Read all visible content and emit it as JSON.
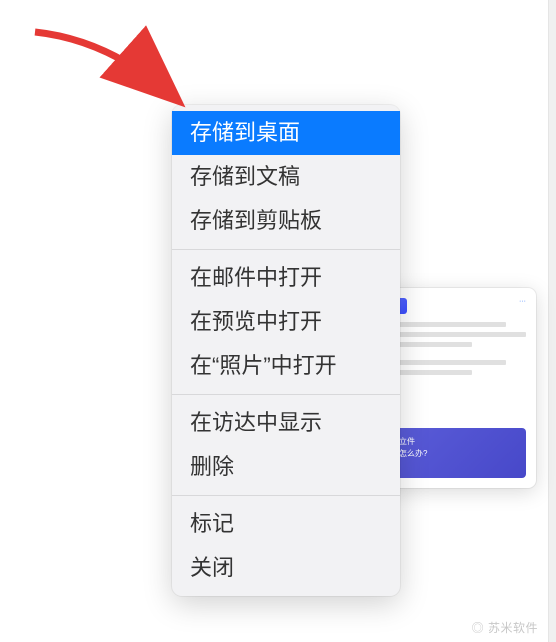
{
  "menu": {
    "groups": [
      [
        {
          "label": "存储到桌面",
          "selected": true
        },
        {
          "label": "存储到文稿",
          "selected": false
        },
        {
          "label": "存储到剪贴板",
          "selected": false
        }
      ],
      [
        {
          "label": "在邮件中打开",
          "selected": false
        },
        {
          "label": "在预览中打开",
          "selected": false
        },
        {
          "label": "在“照片”中打开",
          "selected": false
        }
      ],
      [
        {
          "label": "在访达中显示",
          "selected": false
        },
        {
          "label": "删除",
          "selected": false
        }
      ],
      [
        {
          "label": "标记",
          "selected": false
        },
        {
          "label": "关闭",
          "selected": false
        }
      ]
    ]
  },
  "thumbnail": {
    "banner_line1": "立件",
    "banner_line2": "怎么办?"
  },
  "watermark": "◎ 苏米软件"
}
